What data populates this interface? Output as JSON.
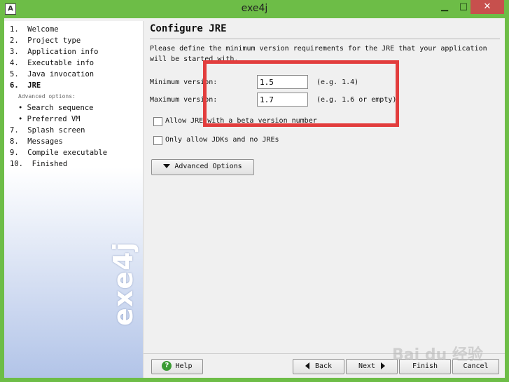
{
  "window": {
    "title": "exe4j",
    "app_icon": "A",
    "minimize_glyph": "▁",
    "maximize_glyph": "□",
    "close_glyph": "✕"
  },
  "sidebar": {
    "steps": [
      {
        "label": "1.  Welcome"
      },
      {
        "label": "2.  Project type"
      },
      {
        "label": "3.  Application info"
      },
      {
        "label": "4.  Executable info"
      },
      {
        "label": "5.  Java invocation"
      },
      {
        "label": "6.  JRE"
      },
      {
        "label": "Advanced options:"
      },
      {
        "label": "• Search sequence"
      },
      {
        "label": "• Preferred VM"
      },
      {
        "label": "7.  Splash screen"
      },
      {
        "label": "8.  Messages"
      },
      {
        "label": "9.  Compile executable"
      },
      {
        "label": "10.  Finished"
      }
    ],
    "logo_text": "exe4j"
  },
  "main": {
    "heading": "Configure JRE",
    "description": "Please define the minimum version requirements for the JRE that your application will be started with.",
    "min_version": {
      "label": "Minimum version:",
      "value": "1.5",
      "hint": "(e.g. 1.4)"
    },
    "max_version": {
      "label": "Maximum version:",
      "value": "1.7",
      "hint": "(e.g. 1.6 or empty)"
    },
    "allow_beta": {
      "label": "Allow JRE with a beta version number",
      "checked": false
    },
    "only_jdks": {
      "label": "Only allow JDKs and no JREs",
      "checked": false
    },
    "advanced_button": "Advanced Options"
  },
  "footer": {
    "help": "Help",
    "back": "Back",
    "next": "Next",
    "finish": "Finish",
    "cancel": "Cancel"
  },
  "overlay": {
    "watermark": "Bai du 经验",
    "highlight_color": "#e23d3d"
  }
}
